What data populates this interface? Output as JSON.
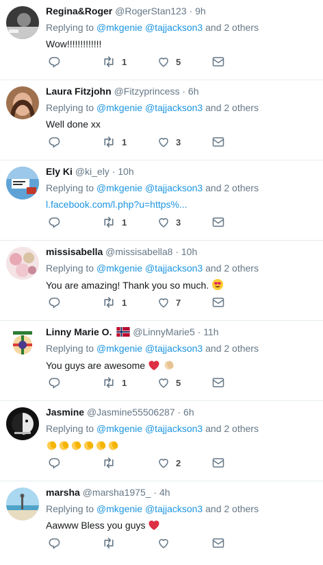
{
  "colors": {
    "accent": "#1b95e0",
    "muted": "#657786",
    "text": "#14171a",
    "divider": "#e6ecf0"
  },
  "replying_label": "Replying to",
  "tweets": [
    {
      "name": "Regina&Roger",
      "handle": "@RogerStan123",
      "time": "9h",
      "mentions": [
        "@mkgenie",
        "@tajjackson3"
      ],
      "others": "and 2 others",
      "text": "Wow!!!!!!!!!!!!!",
      "retweets": "1",
      "likes": "5"
    },
    {
      "name": "Laura Fitzjohn",
      "handle": "@Fitzyprincess",
      "time": "6h",
      "mentions": [
        "@mkgenie",
        "@tajjackson3"
      ],
      "others": "and 2 others",
      "text": "Well done xx",
      "retweets": "1",
      "likes": "3"
    },
    {
      "name": "Ely Ki",
      "handle": "@ki_ely",
      "time": "10h",
      "mentions": [
        "@mkgenie",
        "@tajjackson3"
      ],
      "others": "and 2 others",
      "text": "l.facebook.com/l.php?u=https%...",
      "retweets": "1",
      "likes": "3"
    },
    {
      "name": "missisabella",
      "handle": "@missisabella8",
      "time": "10h",
      "mentions": [
        "@mkgenie",
        "@tajjackson3"
      ],
      "others": "and 2 others",
      "text": "You are amazing! Thank you so much.",
      "emoji": "heart-eyes-emoji",
      "retweets": "1",
      "likes": "7"
    },
    {
      "name": "Linny Marie O.",
      "handle": "@LinnyMarie5",
      "time": "11h",
      "flag": "norway-flag-icon",
      "mentions": [
        "@mkgenie",
        "@tajjackson3"
      ],
      "others": "and 2 others",
      "text": "You guys are awesome",
      "emoji": "heart-and-clap-emoji",
      "retweets": "1",
      "likes": "5"
    },
    {
      "name": "Jasmine",
      "handle": "@Jasmine55506287",
      "time": "6h",
      "mentions": [
        "@mkgenie",
        "@tajjackson3"
      ],
      "others": "and 2 others",
      "text": "",
      "emoji": "six-clap-emoji",
      "retweets": "",
      "likes": "2"
    },
    {
      "name": "marsha",
      "handle": "@marsha1975_",
      "time": "4h",
      "mentions": [
        "@mkgenie",
        "@tajjackson3"
      ],
      "others": "and 2 others",
      "text": "Aawww Bless you guys",
      "emoji": "heart-emoji",
      "retweets": "",
      "likes": ""
    }
  ]
}
